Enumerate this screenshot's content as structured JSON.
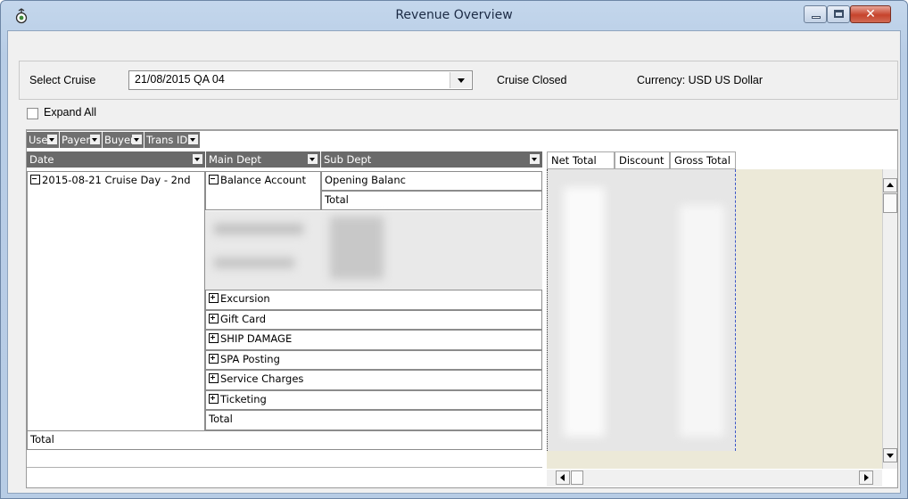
{
  "window": {
    "title": "Revenue Overview"
  },
  "selector": {
    "select_cruise_label": "Select Cruise",
    "cruise_value": "21/08/2015  QA 04",
    "status": "Cruise Closed",
    "currency": "Currency: USD  US Dollar"
  },
  "expand_all_label": "Expand All",
  "group_by": [
    "User",
    "Payer",
    "Buyer",
    "Trans ID"
  ],
  "columns": {
    "date": "Date",
    "main_dept": "Main Dept",
    "sub_dept": "Sub Dept"
  },
  "value_columns": [
    "Net Total",
    "Discount",
    "Gross Total"
  ],
  "rows": {
    "date": "2015-08-21 Cruise Day - 2nd",
    "balance_account": "Balance Account",
    "opening_balance": "Opening Balanc",
    "sub_total": "Total",
    "departments": [
      "Excursion",
      "Gift Card",
      "SHIP DAMAGE",
      "SPA Posting",
      "Service Charges",
      "Ticketing"
    ],
    "dept_total": "Total",
    "grand_total": "Total"
  },
  "colors": {
    "header_bg": "#6a6a6a",
    "blank_area": "#ece9d8",
    "close_red": "#c6432c"
  }
}
